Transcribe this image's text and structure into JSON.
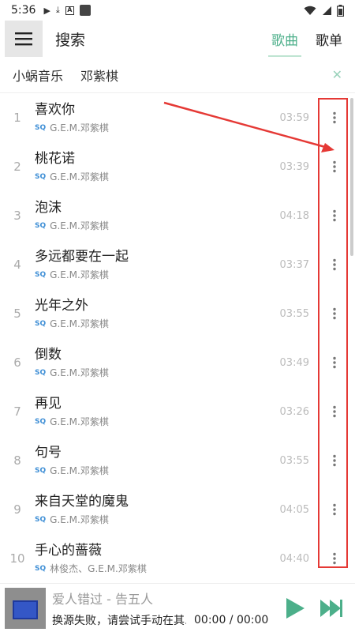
{
  "status_bar": {
    "time": "5:36"
  },
  "toolbar": {
    "title": "搜索",
    "tabs": [
      {
        "label": "歌曲",
        "active": true
      },
      {
        "label": "歌单",
        "active": false
      }
    ]
  },
  "filters": {
    "source": "小蜗音乐",
    "keyword": "邓紫棋",
    "close_icon": "close-icon"
  },
  "songs": [
    {
      "index": "1",
      "title": "喜欢你",
      "quality": "SQ",
      "artist": "G.E.M.邓紫棋",
      "duration": "03:59"
    },
    {
      "index": "2",
      "title": "桃花诺",
      "quality": "SQ",
      "artist": "G.E.M.邓紫棋",
      "duration": "03:39"
    },
    {
      "index": "3",
      "title": "泡沫",
      "quality": "SQ",
      "artist": "G.E.M.邓紫棋",
      "duration": "04:18"
    },
    {
      "index": "4",
      "title": "多远都要在一起",
      "quality": "SQ",
      "artist": "G.E.M.邓紫棋",
      "duration": "03:37"
    },
    {
      "index": "5",
      "title": "光年之外",
      "quality": "SQ",
      "artist": "G.E.M.邓紫棋",
      "duration": "03:55"
    },
    {
      "index": "6",
      "title": "倒数",
      "quality": "SQ",
      "artist": "G.E.M.邓紫棋",
      "duration": "03:49"
    },
    {
      "index": "7",
      "title": "再见",
      "quality": "SQ",
      "artist": "G.E.M.邓紫棋",
      "duration": "03:26"
    },
    {
      "index": "8",
      "title": "句号",
      "quality": "SQ",
      "artist": "G.E.M.邓紫棋",
      "duration": "03:55"
    },
    {
      "index": "9",
      "title": "来自天堂的魔鬼",
      "quality": "SQ",
      "artist": "G.E.M.邓紫棋",
      "duration": "04:05"
    },
    {
      "index": "10",
      "title": "手心的蔷薇",
      "quality": "SQ",
      "artist": "林俊杰、G.E.M.邓紫棋",
      "duration": "04:40"
    }
  ],
  "player": {
    "title": "爱人错过 - 告五人",
    "status": "换源失败，请尝试手动在其...",
    "time": "00:00 / 00:00"
  },
  "colors": {
    "accent": "#4caf8a",
    "annotation": "#e53935",
    "quality_badge": "#3f8fd6"
  }
}
